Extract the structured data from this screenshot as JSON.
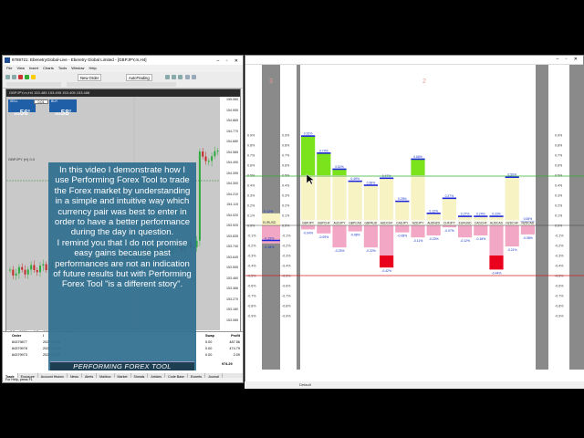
{
  "mt4": {
    "title": "8789721: EbenetryGlobal-Live - Eberetry Global Limited - [GBPJPY,m,H4]",
    "menu": [
      "File",
      "View",
      "Insert",
      "Charts",
      "Tools",
      "Window",
      "Help"
    ],
    "new_order": "New Order",
    "auto_trading": "AutoTrading",
    "chart_header": "GBPJPY,m,H4  153.485 153.495 153.405 153.488",
    "sell_label": "SELL",
    "buy_label": "BUY",
    "lot": "0.01",
    "sell_price": "56",
    "sell_prefix": "153",
    "sell_sup": "6",
    "buy_price": "58",
    "buy_prefix": "153",
    "buy_sup": "3",
    "symbol_label": "GBPJPY (H) 0.0",
    "axis_labels": [
      "155.060",
      "154.955",
      "154.865",
      "154.770",
      "154.680",
      "154.585",
      "154.490",
      "154.395",
      "154.300",
      "154.210",
      "154.115",
      "154.020",
      "153.925",
      "153.835",
      "153.740",
      "153.645",
      "153.555",
      "153.460",
      "153.366",
      "153.270",
      "153.180",
      "153.085"
    ],
    "date_labels": [
      "7 Dec 2021",
      "8 Dec 2021",
      "9 Dec 2021"
    ],
    "terminal": {
      "headers": [
        "Order",
        "/",
        "Swap",
        "Profit"
      ],
      "rows": [
        {
          "order": "84379877",
          "time": "2021.12.20",
          "swap": "0.00",
          "profit": "487.56"
        },
        {
          "order": "84379978",
          "time": "2021.12.20",
          "swap": "0.00",
          "profit": "474.79"
        },
        {
          "order": "84379973",
          "time": "2021.12.20",
          "swap": "0.00",
          "profit": "2.09"
        }
      ],
      "total": "974.29",
      "tabs": [
        "Trade",
        "Exposure",
        "Account History",
        "News",
        "Alerts",
        "Mailbox",
        "Market",
        "Signals",
        "Articles",
        "Code Base",
        "Experts",
        "Journal"
      ]
    },
    "status": "For Help, press F1"
  },
  "overlay": {
    "paragraph1": "In this video I demonstrate how I use Performing Forex Tool to trade the Forex market by understanding in a simple and intuitive way which currency pair was best to enter in order to have a better performance during the day in question.",
    "paragraph2": "I remind you that I do not promise easy gains because past performances are not an indication of future results but with Performing Forex Tool \"is a different story\".",
    "footer": "PERFORMING FOREX TOOL"
  },
  "perf": {
    "left_number": "3",
    "middle_number": "2",
    "left_scale": [
      "0.9%",
      "0.8%",
      "0.7%",
      "0.6%",
      "0.5%",
      "0.4%",
      "0.3%",
      "0.2%",
      "0.1%",
      "0.0%",
      "-0.1%",
      "-0.2%",
      "-0.3%",
      "-0.4%",
      "-0.5%",
      "-0.6%",
      "-0.7%",
      "-0.8%",
      "-0.9%"
    ],
    "single_pair": {
      "name": "EURUSD",
      "value": -0.15,
      "label": "-0.15%",
      "top_label": "0.12%",
      "bot_label": "-0.18%"
    },
    "pairs": [
      {
        "name": "GBPJPY",
        "value": 0.89,
        "label": "0.91%",
        "low": -0.04,
        "low_label": "-0.04%"
      },
      {
        "name": "GBPCHF",
        "value": 0.72,
        "label": "0.74%",
        "low": -0.08,
        "low_label": "-0.09%"
      },
      {
        "name": "AUDJPY",
        "value": 0.56,
        "label": "0.52%",
        "low": -0.22,
        "low_label": "-0.23%"
      },
      {
        "name": "GBPCAD",
        "value": 0.44,
        "label": "0.45%",
        "low": -0.06,
        "low_label": "-0.08%"
      },
      {
        "name": "GBPAUD",
        "value": 0.4,
        "label": "0.38%",
        "low": -0.22,
        "low_label": "-0.22%"
      },
      {
        "name": "AUDCHF",
        "value": 0.47,
        "label": "0.47%",
        "low": -0.42,
        "low_label": "-0.42%"
      },
      {
        "name": "CADJPY",
        "value": 0.24,
        "label": "0.28%",
        "low": -0.07,
        "low_label": "-0.08%"
      },
      {
        "name": "NZDJPY",
        "value": 0.66,
        "label": "0.66%",
        "low": -0.12,
        "low_label": "-0.11%"
      },
      {
        "name": "AUDNZD",
        "value": 0.12,
        "label": "0.12%",
        "low": -0.1,
        "low_label": "-0.23%"
      },
      {
        "name": "CHFJPY",
        "value": 0.27,
        "label": "0.27%",
        "low": -0.02,
        "low_label": "-0.07%"
      },
      {
        "name": "EURUSD",
        "value": 0.09,
        "label": "0.27%",
        "low": -0.12,
        "low_label": "-0.12%"
      },
      {
        "name": "CADCHF",
        "value": 0.09,
        "label": "0.24%",
        "low": -0.1,
        "low_label": "-0.18%"
      },
      {
        "name": "AUDCAD",
        "value": 0.09,
        "label": "0.23%",
        "low": -0.44,
        "low_label": "-0.44%"
      },
      {
        "name": "NZDCHF",
        "value": 0.48,
        "label": "0.50%",
        "low": -0.21,
        "low_label": "-0.21%"
      },
      {
        "name": "NZDCAD",
        "value": 0.04,
        "label": "0.08%",
        "low": -0.09,
        "low_label": "-0.08%"
      }
    ],
    "right_scale": [
      "0.9%",
      "0.8%",
      "0.7%",
      "0.6%",
      "0.5%",
      "0.4%",
      "0.3%",
      "0.2%",
      "0.1%",
      "0.0%",
      "-0.1%",
      "-0.2%",
      "-0.3%",
      "-0.4%",
      "-0.5%",
      "-0.6%",
      "-0.7%",
      "-0.8%",
      "-0.9%"
    ],
    "colors": {
      "positive": "#7ae31c",
      "negative": "#f2a8c4",
      "neutral_band": "#f7f3c3",
      "strong_negative": "#e8001c",
      "bar_line": "#1f28d8",
      "label_blue": "#1434c8"
    },
    "status_text": "Default"
  }
}
